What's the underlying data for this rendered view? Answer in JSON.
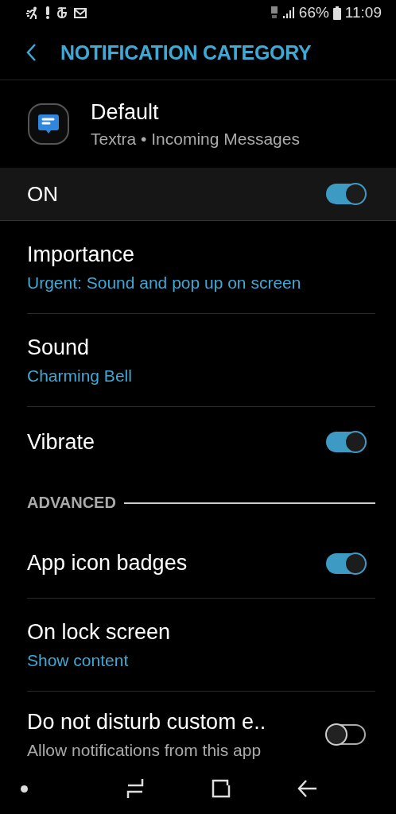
{
  "status_bar": {
    "battery": "66%",
    "time": "11:09"
  },
  "header": {
    "title": "NOTIFICATION CATEGORY"
  },
  "app": {
    "name": "Default",
    "subtitle": "Textra • Incoming Messages"
  },
  "master_switch": {
    "label": "ON",
    "on": true
  },
  "settings": [
    {
      "kind": "value",
      "title": "Importance",
      "value": "Urgent: Sound and pop up on screen"
    },
    {
      "kind": "value",
      "title": "Sound",
      "value": "Charming Bell"
    },
    {
      "kind": "toggle",
      "title": "Vibrate",
      "on": true
    },
    {
      "kind": "section",
      "title": "ADVANCED"
    },
    {
      "kind": "toggle",
      "title": "App icon badges",
      "on": true
    },
    {
      "kind": "value",
      "title": "On lock screen",
      "value": "Show content"
    },
    {
      "kind": "toggle",
      "title": "Do not disturb custom e..",
      "subtitle": "Allow notifications from this app",
      "on": false
    }
  ]
}
